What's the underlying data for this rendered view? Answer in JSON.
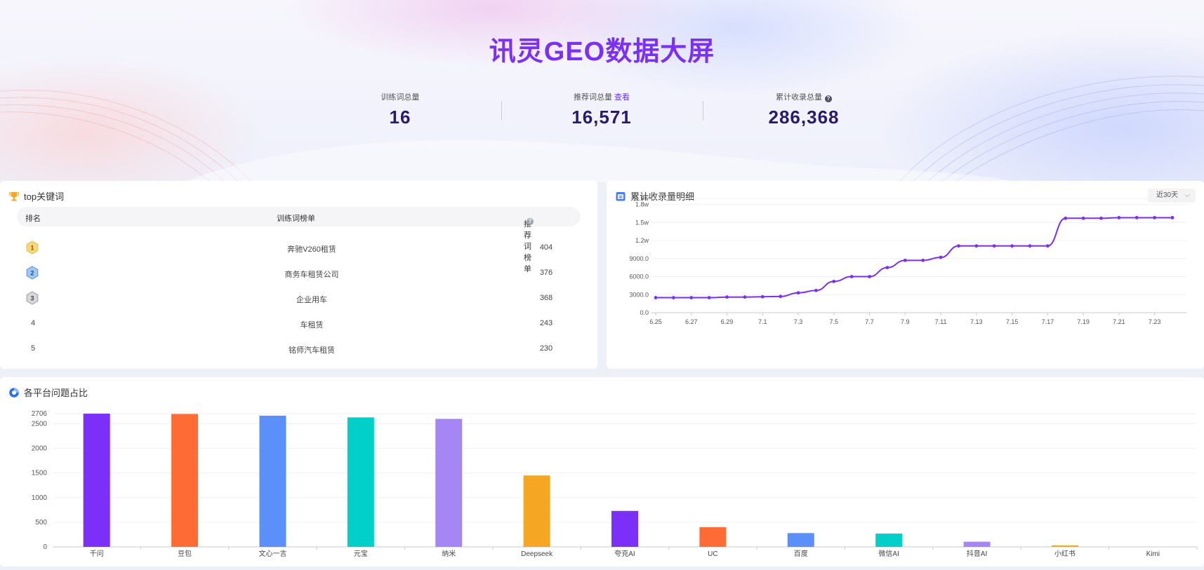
{
  "header": {
    "title": "讯灵GEO数据大屏"
  },
  "kpis": [
    {
      "label": "训练词总量",
      "value": "16"
    },
    {
      "label": "推荐词总量",
      "link": "查看",
      "value": "16,571"
    },
    {
      "label": "累计收录总量",
      "value": "286,368",
      "help": "?"
    }
  ],
  "keywords": {
    "title": "top关键词",
    "columns": [
      "排名",
      "训练词榜单",
      "推荐词榜单"
    ],
    "rows": [
      {
        "rank": "1",
        "keyword": "奔驰V260租赁",
        "count": "404",
        "medal": "gold"
      },
      {
        "rank": "2",
        "keyword": "商务车租赁公司",
        "count": "376",
        "medal": "blue"
      },
      {
        "rank": "3",
        "keyword": "企业用车",
        "count": "368",
        "medal": "silver"
      },
      {
        "rank": "4",
        "keyword": "车租赁",
        "count": "243"
      },
      {
        "rank": "5",
        "keyword": "铭师汽车租赁",
        "count": "230"
      }
    ]
  },
  "indexing": {
    "title": "累计收录量明细",
    "range_label": "近30天"
  },
  "platforms": {
    "title": "各平台问题占比"
  },
  "colors": {
    "accent": "#7b2ff7",
    "line": "#7a2ff2"
  },
  "chart_data": [
    {
      "type": "line",
      "title": "累计收录量明细",
      "x": [
        "6.25",
        "6.26",
        "6.27",
        "6.28",
        "6.29",
        "6.30",
        "7.1",
        "7.2",
        "7.3",
        "7.4",
        "7.5",
        "7.6",
        "7.7",
        "7.8",
        "7.9",
        "7.10",
        "7.11",
        "7.12",
        "7.13",
        "7.14",
        "7.15",
        "7.16",
        "7.17",
        "7.18",
        "7.19",
        "7.20",
        "7.21",
        "7.22",
        "7.23",
        "7.24"
      ],
      "x_tick_labels": [
        "6.25",
        "6.27",
        "6.29",
        "7.1",
        "7.3",
        "7.5",
        "7.7",
        "7.9",
        "7.11",
        "7.13",
        "7.15",
        "7.17",
        "7.19",
        "7.21",
        "7.23"
      ],
      "values": [
        2500,
        2500,
        2500,
        2500,
        2600,
        2600,
        2650,
        2700,
        3300,
        3700,
        5200,
        6000,
        6000,
        7500,
        8700,
        8700,
        9200,
        11100,
        11100,
        11100,
        11100,
        11100,
        11100,
        15700,
        15700,
        15700,
        15800,
        15800,
        15800,
        15800
      ],
      "y_ticks": [
        "0.0",
        "3000.0",
        "6000.0",
        "9000.0",
        "1.2w",
        "1.5w",
        "1.8w",
        "1.9w"
      ],
      "y_tick_values": [
        0,
        3000,
        6000,
        9000,
        12000,
        15000,
        18000,
        19000
      ],
      "ylim": [
        0,
        19000
      ],
      "grid": true
    },
    {
      "type": "bar",
      "title": "各平台问题占比",
      "categories": [
        "千问",
        "豆包",
        "文心一言",
        "元宝",
        "纳米",
        "Deepseek",
        "夸克AI",
        "UC",
        "百度",
        "微信AI",
        "抖音AI",
        "小红书",
        "Kimi"
      ],
      "values": [
        2706,
        2700,
        2665,
        2630,
        2600,
        1450,
        730,
        400,
        280,
        270,
        105,
        30,
        0
      ],
      "colors": [
        "#7b2ff7",
        "#ff6b35",
        "#5b8ff9",
        "#00d0c9",
        "#a685f5",
        "#f5a623",
        "#7b2ff7",
        "#ff6b35",
        "#5b8ff9",
        "#00d0c9",
        "#a685f5",
        "#f5a623",
        "#7b2ff7"
      ],
      "y_ticks": [
        "0",
        "500",
        "1000",
        "1500",
        "2000",
        "2500",
        "2706"
      ],
      "y_tick_values": [
        0,
        500,
        1000,
        1500,
        2000,
        2500,
        2706
      ],
      "ylim": [
        0,
        2706
      ],
      "grid": true
    }
  ]
}
